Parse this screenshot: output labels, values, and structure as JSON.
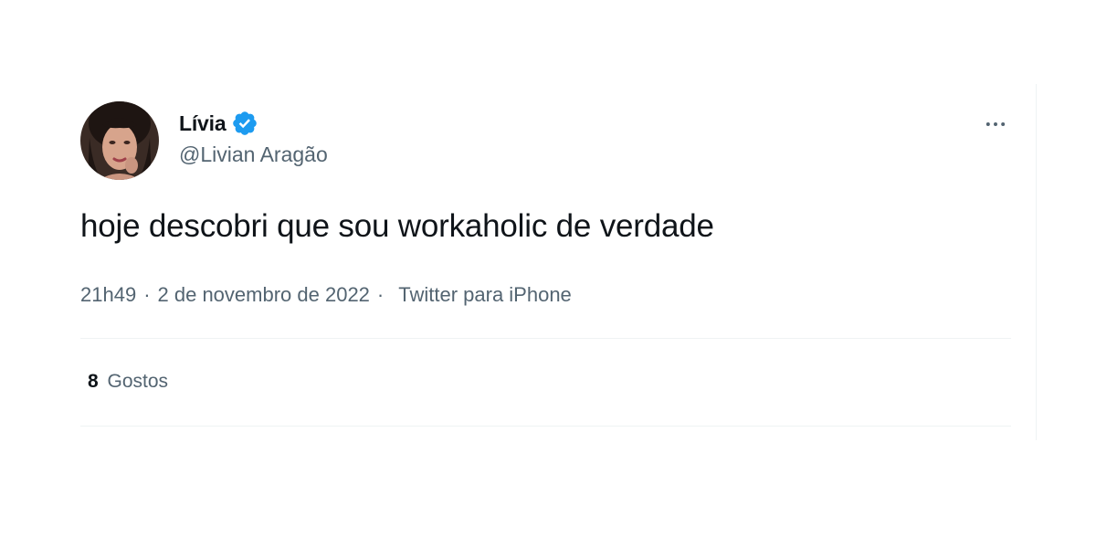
{
  "author": {
    "display_name": "Lívia",
    "handle": "@Livian Aragão",
    "avatar_icon": "profile-photo",
    "verified_icon": "verified-badge-icon",
    "verified_color": "#1d9bf0"
  },
  "tweet": {
    "text": "hoje descobri que sou workaholic de verdade",
    "time": "21h49",
    "date": "2 de novembro de 2022",
    "separator": "·",
    "source": "Twitter para iPhone"
  },
  "stats": {
    "likes_count": "8",
    "likes_label": "Gostos"
  },
  "more_icon": "more-horizontal-icon",
  "colors": {
    "text_primary": "#0f1419",
    "text_secondary": "#536471",
    "divider": "#eff3f4"
  }
}
